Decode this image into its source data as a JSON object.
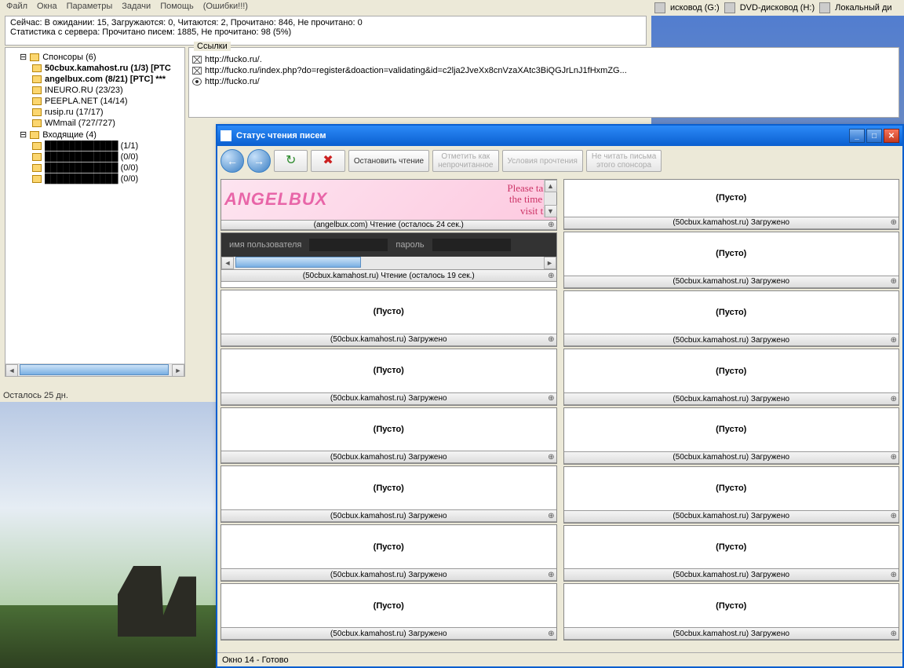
{
  "drives": {
    "g": "исковод (G:)",
    "h": "DVD-дисковод (H:)",
    "local": "Локальный ди"
  },
  "menu": [
    "Файл",
    "Окна",
    "Параметры",
    "Задачи",
    "Помощь",
    "(Ошибки!!!)"
  ],
  "status1": "Сейчас: В ожидании: 15, Загружаются: 0, Читаются: 2, Прочитано: 846, Не прочитано: 0",
  "status2": "Статистика с сервера: Прочитано писем: 1885, Не прочитано: 98 (5%)",
  "tree": {
    "root1": "Спонсоры (6)",
    "items1": [
      {
        "t": "50cbux.kamahost.ru (1/3) [PTC",
        "b": true
      },
      {
        "t": "angelbux.com (8/21) [PTC] ***",
        "b": true
      },
      {
        "t": "INEURO.RU (23/23)"
      },
      {
        "t": "PEEPLA.NET (14/14)"
      },
      {
        "t": "rusip.ru (17/17)"
      },
      {
        "t": "WMmail (727/727)"
      }
    ],
    "root2": "Входящие (4)",
    "items2": [
      {
        "t": "████████████ (1/1)"
      },
      {
        "t": "████████████ (0/0)"
      },
      {
        "t": "████████████ (0/0)"
      },
      {
        "t": "████████████ (0/0)"
      }
    ]
  },
  "links_title": "Ссылки",
  "links": [
    {
      "icon": "mail",
      "url": "http://fucko.ru/."
    },
    {
      "icon": "mail",
      "url": "http://fucko.ru/index.php?do=register&doaction=validating&id=c2lja2JveXx8cnVzaXAtc3BiQGJrLnJ1fHxmZG..."
    },
    {
      "icon": "eye",
      "url": "http://fucko.ru/"
    }
  ],
  "footer_left": "Осталось 25 дн.",
  "window": {
    "title": "Статус чтения писем",
    "btns": {
      "stop": "Остановить чтение",
      "unread": "Отметить как\nнепрочитанное",
      "terms": "Условия прочтения",
      "noread": "Не читать письма\nэтого спонсора"
    },
    "ad": {
      "logo": "ANGELBUX",
      "txt": "Please take\nthe time to\nvisit the"
    },
    "login": {
      "user": "имя пользователя",
      "pass": "пароль"
    },
    "head1": "(angelbux.com) Чтение (осталось 24 сек.)",
    "head2": "(50cbux.kamahost.ru) Чтение (осталось 19 сек.)",
    "loaded": "(50cbux.kamahost.ru) Загружено",
    "empty": "(Пусто)",
    "statusbar": "Окно 14 - Готово"
  }
}
